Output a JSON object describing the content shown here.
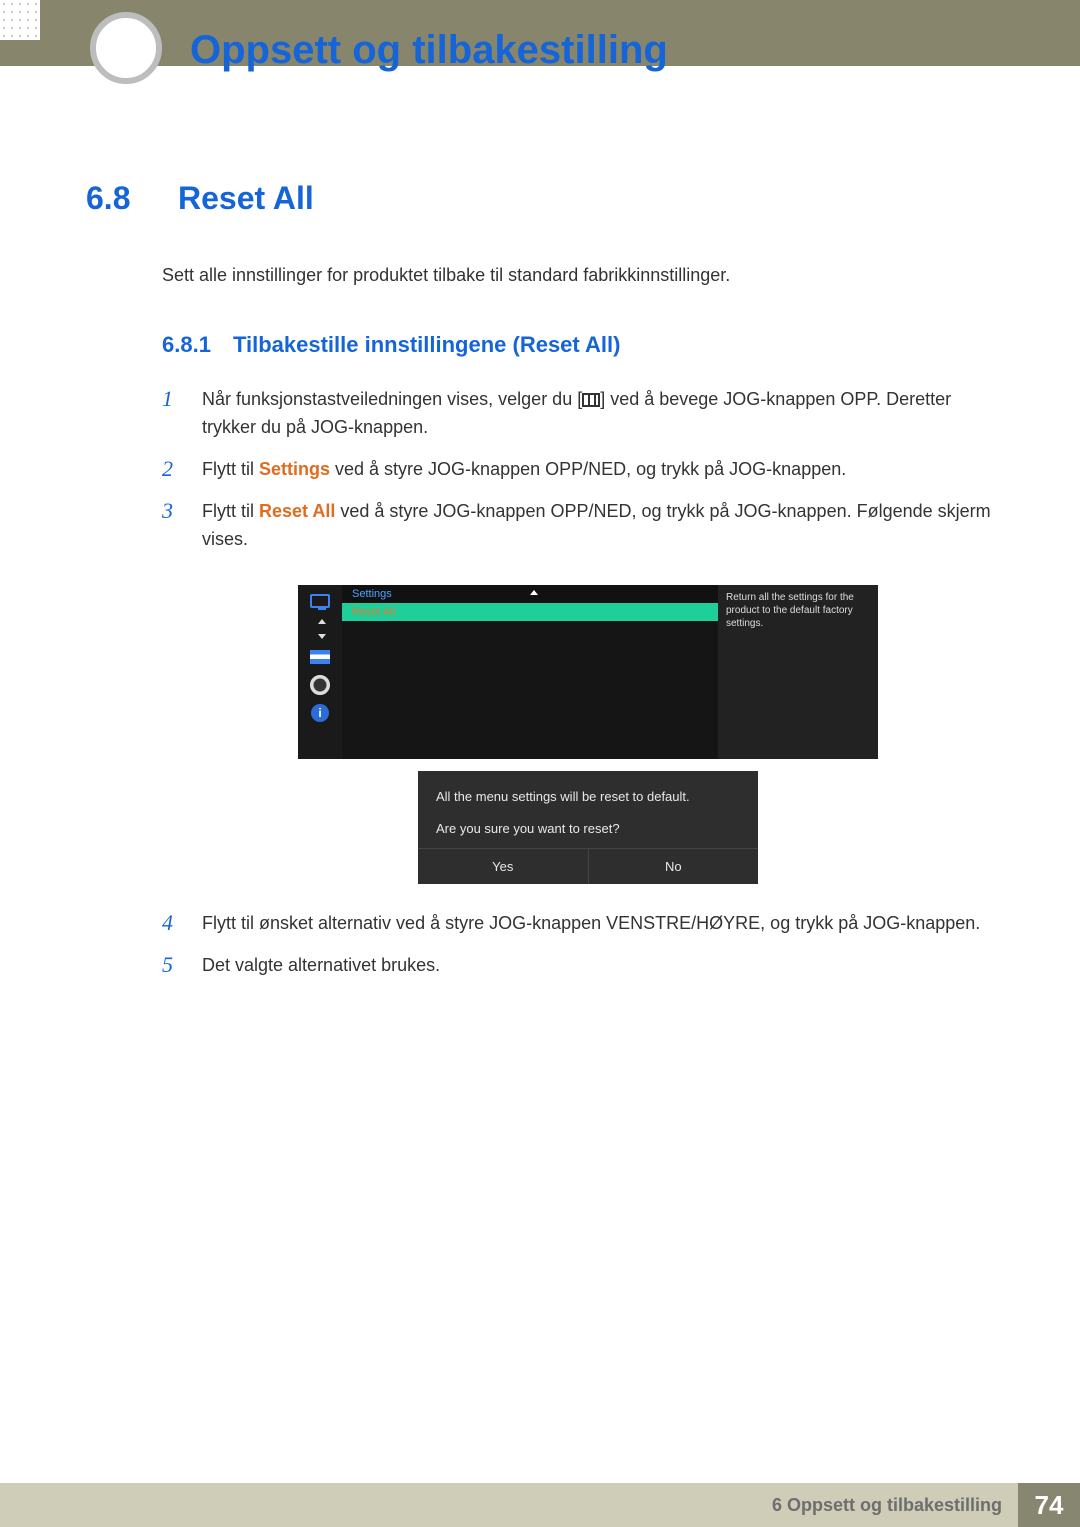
{
  "chapter": {
    "title": "Oppsett og tilbakestilling"
  },
  "section": {
    "number": "6.8",
    "title": "Reset All"
  },
  "intro": "Sett alle innstillinger for produktet tilbake til standard fabrikkinnstillinger.",
  "subsection": {
    "number": "6.8.1",
    "title": "Tilbakestille innstillingene (Reset All)"
  },
  "steps": {
    "s1a": "Når funksjonstastveiledningen vises, velger du [",
    "s1b": "] ved å bevege JOG-knappen OPP. Deretter trykker du på JOG-knappen.",
    "s2a": "Flytt til ",
    "s2_settings": "Settings",
    "s2b": " ved å styre JOG-knappen OPP/NED, og trykk på JOG-knappen.",
    "s3a": "Flytt til ",
    "s3_reset": "Reset All",
    "s3b": " ved å styre JOG-knappen OPP/NED, og trykk på JOG-knappen. Følgende skjerm vises.",
    "s4": "Flytt til ønsket alternativ ved å styre JOG-knappen VENSTRE/HØYRE, og trykk på JOG-knappen.",
    "s5": "Det valgte alternativet brukes."
  },
  "osd": {
    "crumb": "Settings",
    "selected": "Reset All",
    "help": "Return all the settings for the product to the default factory settings.",
    "info_glyph": "i"
  },
  "dialog": {
    "line1": "All the menu settings will be reset to default.",
    "line2": "Are you sure you want to reset?",
    "yes": "Yes",
    "no": "No"
  },
  "footer": {
    "label": "6 Oppsett og tilbakestilling",
    "page": "74"
  }
}
